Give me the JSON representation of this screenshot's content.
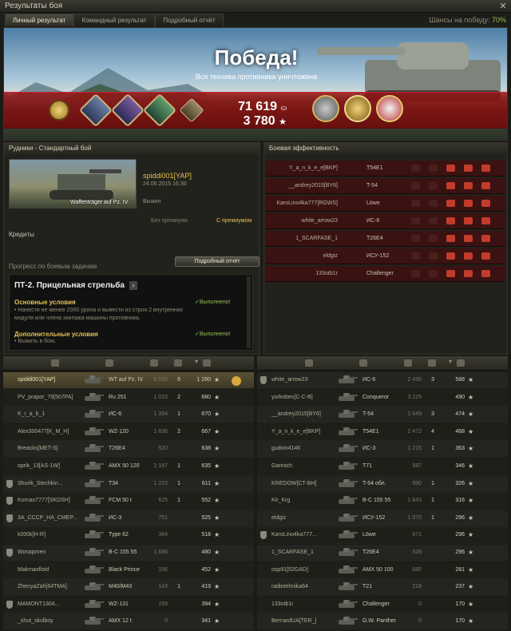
{
  "window": {
    "title": "Результаты боя",
    "close": "✕"
  },
  "tabs": [
    {
      "label": "Личный результат"
    },
    {
      "label": "Командный результат"
    },
    {
      "label": "Подробный отчёт"
    }
  ],
  "chance": {
    "label": "Шансы на победу:",
    "value": "70%"
  },
  "banner": {
    "title": "Победа!",
    "subtitle": "Вся техника противника уничтожена",
    "credits": "71 619",
    "xp": "3 780",
    "credit_icon": "coin-icon",
    "xp_icon": "star-icon"
  },
  "battle": {
    "map_mode": "Рудники - Стандартный бой",
    "player": "spiddi001[YAP]",
    "date": "24.06.2015 16:30",
    "status": "Выжил",
    "tank": "Waffenträger auf Pz. IV",
    "no_premium": "Без премиума",
    "premium": "С премиумом",
    "credits_label": "Кредиты"
  },
  "progress": {
    "title": "Прогресс по боевым задачам",
    "detail_button": "Подробный отчёт",
    "task_title": "ПТ-2. Прицельная стрельба",
    "arrow": "›",
    "main_label": "Основные условия",
    "main_status": "✓Выполнено!",
    "main_text": "• Нанести не менее 2000 урона и вывести из строя 2 внутренних модуля или члена экипажа машины противника.",
    "extra_label": "Дополнительные условия",
    "extra_status": "✓Выполнено!",
    "extra_text": "• Выжить в бою."
  },
  "efficiency": {
    "title": "Боевая эффективность",
    "rows": [
      {
        "player": "Y_a_n_k_e_e[BKP]",
        "tank": "T54E1"
      },
      {
        "player": "__andrey2015[BY6]",
        "tank": "T-54"
      },
      {
        "player": "KaroLino4ka777[RGWS]",
        "tank": "Löwe"
      },
      {
        "player": "white_arrow23",
        "tank": "ИС-6"
      },
      {
        "player": "1_SCARFASE_1",
        "tank": "T26E4"
      },
      {
        "player": "eldgiz",
        "tank": "ИСУ-152"
      },
      {
        "player": "133otb1r",
        "tank": "Challenger"
      }
    ]
  },
  "ally": [
    {
      "player": "spiddi001[YAP]",
      "tank": "WT auf Pz. IV",
      "damage": "6 035",
      "kills": "6",
      "xp": "1 260",
      "highlight": true,
      "badge": "sun"
    },
    {
      "player": "PV_prapor_79[507PA]",
      "tank": "Ru 251",
      "damage": "1 015",
      "kills": "2",
      "xp": "680"
    },
    {
      "player": "K_r_a_b_1",
      "tank": "ИС-6",
      "damage": "1 354",
      "kills": "1",
      "xp": "670"
    },
    {
      "player": "Alex300477[K_M_H]",
      "tank": "WZ-120",
      "damage": "1 836",
      "kills": "2",
      "xp": "667"
    },
    {
      "player": "Breacks[MET-S]",
      "tank": "T26E4",
      "damage": "520",
      "kills": "",
      "xp": "638"
    },
    {
      "player": "oprik_13[AS-1W]",
      "tank": "AMX 50 120",
      "damage": "2 167",
      "kills": "1",
      "xp": "635"
    },
    {
      "player": "Shurik_Stechkin...",
      "tank": "T34",
      "damage": "1 223",
      "kills": "1",
      "xp": "611",
      "badge": "shield"
    },
    {
      "player": "Kornax7777[SKDSH]",
      "tank": "FCM 50 t",
      "damage": "625",
      "kills": "1",
      "xp": "552",
      "badge": "shield"
    },
    {
      "player": "3A_CCCP_HA_CMEP...",
      "tank": "ИС-3",
      "damage": "751",
      "kills": "",
      "xp": "525",
      "badge": "shield"
    },
    {
      "player": "k000k[H-R]",
      "tank": "Type 62",
      "damage": "364",
      "kills": "",
      "xp": "518"
    },
    {
      "player": "Wosapmen",
      "tank": "В-С 155 55",
      "damage": "1 686",
      "kills": "",
      "xp": "480",
      "badge": "shield"
    },
    {
      "player": "Makmaxfloid",
      "tank": "Black Prince",
      "damage": "156",
      "kills": "",
      "xp": "452"
    },
    {
      "player": "ZhenyaZah[64TMA]",
      "tank": "M40/M43",
      "damage": "143",
      "kills": "1",
      "xp": "419"
    },
    {
      "player": "MAMONT1304...",
      "tank": "WZ-131",
      "damage": "159",
      "kills": "",
      "xp": "394",
      "badge": "shield"
    },
    {
      "player": "_shut_skulboy",
      "tank": "AMX 12 t",
      "damage": "0",
      "kills": "",
      "xp": "341"
    }
  ],
  "enemy": [
    {
      "player": "white_arrow23",
      "tank": "ИС-6",
      "damage": "2 495",
      "kills": "3",
      "xp": "588",
      "badge": "shield"
    },
    {
      "player": "yurkobes[C-C-B]",
      "tank": "Conqueror",
      "damage": "3 225",
      "kills": "",
      "xp": "490"
    },
    {
      "player": "__andrey2015[BY6]",
      "tank": "T-54",
      "damage": "1 649",
      "kills": "3",
      "xp": "474"
    },
    {
      "player": "Y_a_n_k_e_e[BKP]",
      "tank": "T54E1",
      "damage": "2 472",
      "kills": "4",
      "xp": "468"
    },
    {
      "player": "gudvin4146",
      "tank": "ИС-3",
      "damage": "1 215",
      "kills": "1",
      "xp": "363"
    },
    {
      "player": "Gannich",
      "tank": "T71",
      "damage": "587",
      "kills": "",
      "xp": "346"
    },
    {
      "player": "KREDOW[CT-BH]",
      "tank": "T-54 обл.",
      "damage": "990",
      "kills": "1",
      "xp": "326"
    },
    {
      "player": "Kir_Krg",
      "tank": "В-С 155 55",
      "damage": "1 843",
      "kills": "1",
      "xp": "316"
    },
    {
      "player": "eldgiz",
      "tank": "ИСУ-152",
      "damage": "1 070",
      "kills": "1",
      "xp": "296"
    },
    {
      "player": "KaroLino4ka777...",
      "tank": "Löwe",
      "damage": "671",
      "kills": "",
      "xp": "296",
      "badge": "shield"
    },
    {
      "player": "1_SCARFASE_1",
      "tank": "T26E4",
      "damage": "528",
      "kills": "",
      "xp": "296"
    },
    {
      "player": "osp91[52GAD]",
      "tank": "AMX 50 100",
      "damage": "680",
      "kills": "",
      "xp": "281"
    },
    {
      "player": "radiotehnika64",
      "tank": "T21",
      "damage": "218",
      "kills": "",
      "xp": "237"
    },
    {
      "player": "133otb1r",
      "tank": "Challenger",
      "damage": "0",
      "kills": "",
      "xp": "170"
    },
    {
      "player": "BernardUA[TER_]",
      "tank": "G.W. Panther",
      "damage": "0",
      "kills": "",
      "xp": "170"
    }
  ],
  "star": "★",
  "colors": {
    "accent": "#95c14a",
    "victory_band": "#8e1616",
    "premium": "#e7c150"
  }
}
